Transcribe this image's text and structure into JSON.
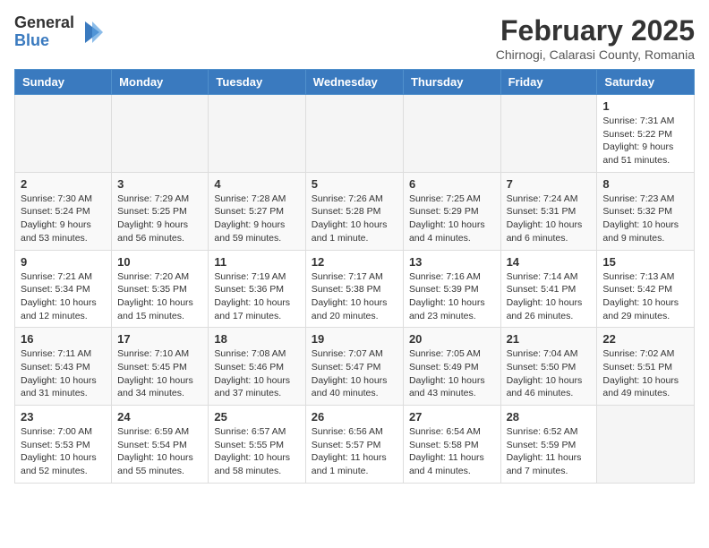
{
  "header": {
    "logo_general": "General",
    "logo_blue": "Blue",
    "month_year": "February 2025",
    "location": "Chirnogi, Calarasi County, Romania"
  },
  "days_of_week": [
    "Sunday",
    "Monday",
    "Tuesday",
    "Wednesday",
    "Thursday",
    "Friday",
    "Saturday"
  ],
  "weeks": [
    [
      {
        "day": "",
        "info": ""
      },
      {
        "day": "",
        "info": ""
      },
      {
        "day": "",
        "info": ""
      },
      {
        "day": "",
        "info": ""
      },
      {
        "day": "",
        "info": ""
      },
      {
        "day": "",
        "info": ""
      },
      {
        "day": "1",
        "info": "Sunrise: 7:31 AM\nSunset: 5:22 PM\nDaylight: 9 hours and 51 minutes."
      }
    ],
    [
      {
        "day": "2",
        "info": "Sunrise: 7:30 AM\nSunset: 5:24 PM\nDaylight: 9 hours and 53 minutes."
      },
      {
        "day": "3",
        "info": "Sunrise: 7:29 AM\nSunset: 5:25 PM\nDaylight: 9 hours and 56 minutes."
      },
      {
        "day": "4",
        "info": "Sunrise: 7:28 AM\nSunset: 5:27 PM\nDaylight: 9 hours and 59 minutes."
      },
      {
        "day": "5",
        "info": "Sunrise: 7:26 AM\nSunset: 5:28 PM\nDaylight: 10 hours and 1 minute."
      },
      {
        "day": "6",
        "info": "Sunrise: 7:25 AM\nSunset: 5:29 PM\nDaylight: 10 hours and 4 minutes."
      },
      {
        "day": "7",
        "info": "Sunrise: 7:24 AM\nSunset: 5:31 PM\nDaylight: 10 hours and 6 minutes."
      },
      {
        "day": "8",
        "info": "Sunrise: 7:23 AM\nSunset: 5:32 PM\nDaylight: 10 hours and 9 minutes."
      }
    ],
    [
      {
        "day": "9",
        "info": "Sunrise: 7:21 AM\nSunset: 5:34 PM\nDaylight: 10 hours and 12 minutes."
      },
      {
        "day": "10",
        "info": "Sunrise: 7:20 AM\nSunset: 5:35 PM\nDaylight: 10 hours and 15 minutes."
      },
      {
        "day": "11",
        "info": "Sunrise: 7:19 AM\nSunset: 5:36 PM\nDaylight: 10 hours and 17 minutes."
      },
      {
        "day": "12",
        "info": "Sunrise: 7:17 AM\nSunset: 5:38 PM\nDaylight: 10 hours and 20 minutes."
      },
      {
        "day": "13",
        "info": "Sunrise: 7:16 AM\nSunset: 5:39 PM\nDaylight: 10 hours and 23 minutes."
      },
      {
        "day": "14",
        "info": "Sunrise: 7:14 AM\nSunset: 5:41 PM\nDaylight: 10 hours and 26 minutes."
      },
      {
        "day": "15",
        "info": "Sunrise: 7:13 AM\nSunset: 5:42 PM\nDaylight: 10 hours and 29 minutes."
      }
    ],
    [
      {
        "day": "16",
        "info": "Sunrise: 7:11 AM\nSunset: 5:43 PM\nDaylight: 10 hours and 31 minutes."
      },
      {
        "day": "17",
        "info": "Sunrise: 7:10 AM\nSunset: 5:45 PM\nDaylight: 10 hours and 34 minutes."
      },
      {
        "day": "18",
        "info": "Sunrise: 7:08 AM\nSunset: 5:46 PM\nDaylight: 10 hours and 37 minutes."
      },
      {
        "day": "19",
        "info": "Sunrise: 7:07 AM\nSunset: 5:47 PM\nDaylight: 10 hours and 40 minutes."
      },
      {
        "day": "20",
        "info": "Sunrise: 7:05 AM\nSunset: 5:49 PM\nDaylight: 10 hours and 43 minutes."
      },
      {
        "day": "21",
        "info": "Sunrise: 7:04 AM\nSunset: 5:50 PM\nDaylight: 10 hours and 46 minutes."
      },
      {
        "day": "22",
        "info": "Sunrise: 7:02 AM\nSunset: 5:51 PM\nDaylight: 10 hours and 49 minutes."
      }
    ],
    [
      {
        "day": "23",
        "info": "Sunrise: 7:00 AM\nSunset: 5:53 PM\nDaylight: 10 hours and 52 minutes."
      },
      {
        "day": "24",
        "info": "Sunrise: 6:59 AM\nSunset: 5:54 PM\nDaylight: 10 hours and 55 minutes."
      },
      {
        "day": "25",
        "info": "Sunrise: 6:57 AM\nSunset: 5:55 PM\nDaylight: 10 hours and 58 minutes."
      },
      {
        "day": "26",
        "info": "Sunrise: 6:56 AM\nSunset: 5:57 PM\nDaylight: 11 hours and 1 minute."
      },
      {
        "day": "27",
        "info": "Sunrise: 6:54 AM\nSunset: 5:58 PM\nDaylight: 11 hours and 4 minutes."
      },
      {
        "day": "28",
        "info": "Sunrise: 6:52 AM\nSunset: 5:59 PM\nDaylight: 11 hours and 7 minutes."
      },
      {
        "day": "",
        "info": ""
      }
    ]
  ]
}
